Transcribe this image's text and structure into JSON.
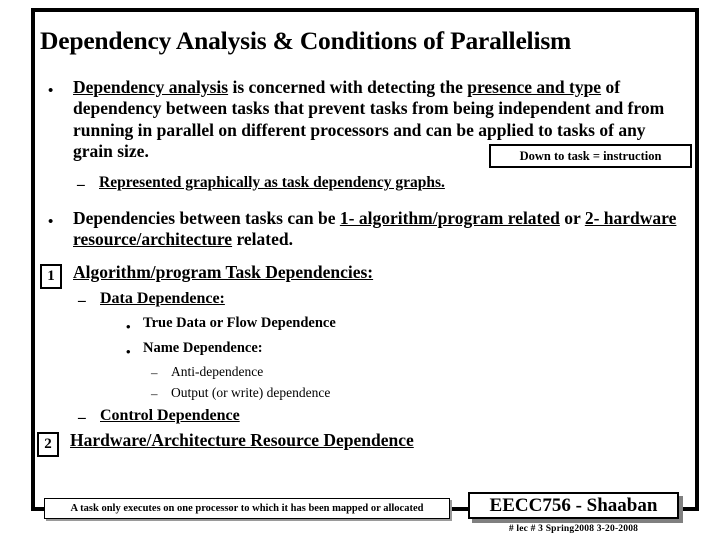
{
  "slide": {
    "title": "Dependency Analysis & Conditions of Parallelism",
    "bullet_glyph": "•",
    "dash_glyph": "–",
    "dot_glyph": "•"
  },
  "body": {
    "para1": {
      "seg1": "Dependency analysis",
      "seg2": " is concerned with detecting the ",
      "seg3": "presence and type",
      "seg4": " of dependency between tasks that prevent tasks from being independent and from running in parallel on different processors and can be applied to tasks of any grain size."
    },
    "callout": {
      "text": "Down to task = instruction"
    },
    "sub1": {
      "text": "Represented graphically as task dependency graphs."
    },
    "para2": {
      "seg1": "Dependencies between tasks can be ",
      "seg2": "1- algorithm/program related",
      "seg3": " or ",
      "seg4": "2- hardware resource/architecture",
      "seg5": " related."
    },
    "item1": {
      "number": "1",
      "heading": "Algorithm/program Task Dependencies:"
    },
    "level2_a": "Data Dependence:",
    "level3_a": "True Data or Flow Dependence",
    "level3_b": "Name Dependence:",
    "level4_a": "Anti-dependence",
    "level4_b": "Output (or write) dependence",
    "level2_b": "Control Dependence",
    "item2": {
      "number": "2",
      "heading": "Hardware/Architecture Resource Dependence"
    }
  },
  "footer": {
    "note": "A task only executes on one processor to which it has been mapped or allocated",
    "course": "EECC756 - Shaaban",
    "course_sub": "#  lec # 3    Spring2008   3-20-2008"
  },
  "colors": {
    "background": "#ffffff",
    "text": "#000000",
    "frame": "#000000",
    "shadow": "#808080"
  }
}
